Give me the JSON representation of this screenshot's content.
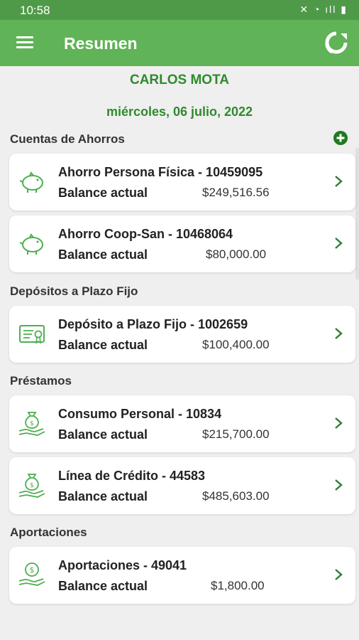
{
  "status_bar": {
    "time": "10:58",
    "icons": "✕ ◔ ıll ▮"
  },
  "app_bar": {
    "title": "Resumen",
    "menu_icon": "menu-icon",
    "refresh_icon": "refresh-icon"
  },
  "user": {
    "name": "CARLOS MOTA",
    "date": "miércoles, 06 julio, 2022"
  },
  "colors": {
    "primary": "#60b356",
    "status": "#4f9a49",
    "accent_text": "#2f8a2c",
    "background": "#efefef"
  },
  "sections": {
    "savings": {
      "title": "Cuentas de Ahorros",
      "accounts": [
        {
          "name": "Ahorro Persona Física - 10459095",
          "balance_label": "Balance actual",
          "balance": "$249,516.56"
        },
        {
          "name": "Ahorro Coop-San - 10468064",
          "balance_label": "Balance actual",
          "balance": "$80,000.00"
        }
      ]
    },
    "deposits": {
      "title": "Depósitos a Plazo Fijo",
      "accounts": [
        {
          "name": "Depósito a Plazo Fijo - 1002659",
          "balance_label": "Balance actual",
          "balance": "$100,400.00"
        }
      ]
    },
    "loans": {
      "title": "Préstamos",
      "accounts": [
        {
          "name": "Consumo Personal - 10834",
          "balance_label": "Balance actual",
          "balance": "$215,700.00"
        },
        {
          "name": "Línea de Crédito - 44583",
          "balance_label": "Balance actual",
          "balance": "$485,603.00"
        }
      ]
    },
    "contributions": {
      "title": "Aportaciones",
      "accounts": [
        {
          "name": "Aportaciones - 49041",
          "balance_label": "Balance actual",
          "balance": "$1,800.00"
        }
      ]
    }
  }
}
